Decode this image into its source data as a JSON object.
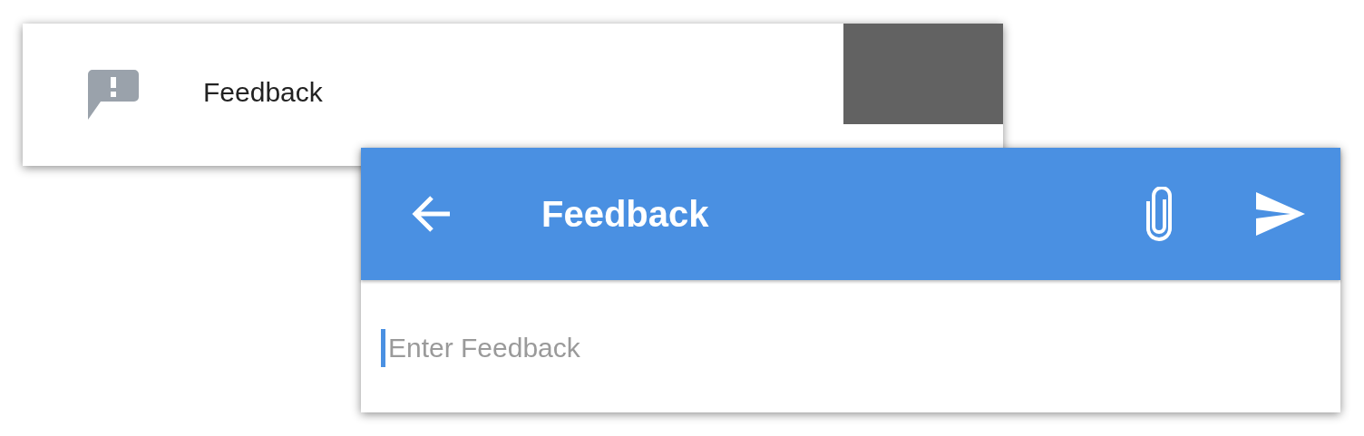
{
  "menu_item": {
    "label": "Feedback"
  },
  "toolbar": {
    "title": "Feedback"
  },
  "feedback_field": {
    "placeholder": "Enter Feedback",
    "focused": true
  }
}
